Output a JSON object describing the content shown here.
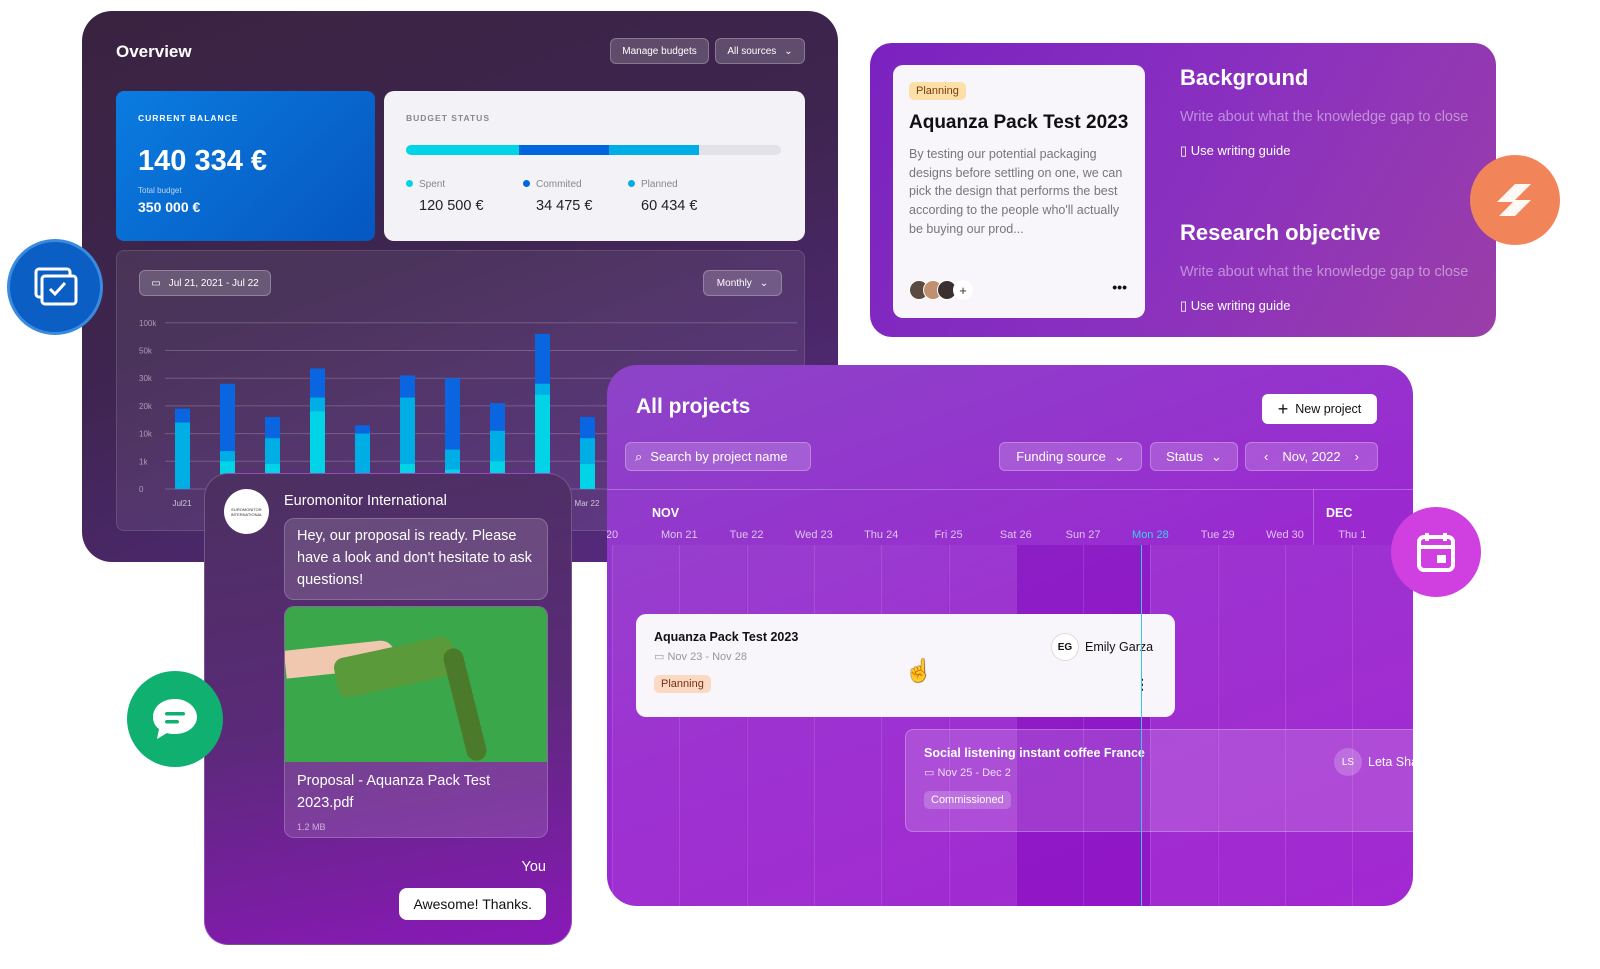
{
  "overview": {
    "title": "Overview",
    "manage_budgets": "Manage budgets",
    "all_sources": "All sources",
    "balance": {
      "label": "CURRENT BALANCE",
      "value": "140 334 €",
      "total_label": "Total budget",
      "total_value": "350 000 €"
    },
    "budget_status": {
      "label": "BUDGET STATUS",
      "progress": {
        "spent": 0.3,
        "committed": 0.24,
        "planned": 0.24
      },
      "items": [
        {
          "name": "Spent",
          "value": "120 500 €",
          "color": "#00d4e6"
        },
        {
          "name": "Commited",
          "value": "34 475 €",
          "color": "#0066e0"
        },
        {
          "name": "Planned",
          "value": "60 434 €",
          "color": "#00aee6"
        }
      ]
    },
    "date_range": "Jul 21, 2021 - Jul 22",
    "period": "Monthly"
  },
  "chart_data": {
    "type": "bar",
    "stacked": true,
    "y_scale": "categorical-nonlinear",
    "y_ticks": [
      "0",
      "1k",
      "10k",
      "20k",
      "30k",
      "50k",
      "100k"
    ],
    "grid": true,
    "x_labels": [
      "Jul21",
      "",
      "",
      "",
      "",
      "",
      "",
      "",
      "",
      "Mar 22"
    ],
    "series": [
      {
        "color": "#00d4e6",
        "values": [
          0,
          1000,
          900,
          18000,
          0,
          900,
          700,
          1000,
          24000,
          900
        ]
      },
      {
        "color": "#00aee6",
        "values": [
          14000,
          4300,
          8500,
          23000,
          10000,
          23000,
          4800,
          11000,
          28000,
          8500
        ]
      },
      {
        "color": "#0a66e0",
        "values": [
          19000,
          28000,
          16000,
          37000,
          13000,
          32000,
          30000,
          21000,
          80000,
          16000
        ]
      }
    ],
    "note_values": "cumulative stack tops"
  },
  "research": {
    "tag": "Planning",
    "title": "Aquanza Pack Test 2023",
    "description": "By testing our potential packaging designs before settling on one, we can pick the design that performs the best according to the people who'll actually be buying our prod...",
    "sections": [
      {
        "title": "Background",
        "placeholder": "Write about what the knowledge gap to close",
        "guide": "Use writing guide"
      },
      {
        "title": "Research objective",
        "placeholder": "Write about what the knowledge gap to close",
        "guide": "Use writing guide"
      }
    ]
  },
  "projects": {
    "title": "All projects",
    "new_project": "New project",
    "search_placeholder": "Search by project name",
    "funding_source": "Funding source",
    "status": "Status",
    "month": "Nov, 2022",
    "months": [
      "NOV",
      "DEC"
    ],
    "days": [
      "20",
      "Mon 21",
      "Tue 22",
      "Wed 23",
      "Thu 24",
      "Fri 25",
      "Sat 26",
      "Sun 27",
      "Mon 28",
      "Tue 29",
      "Wed 30",
      "Thu 1"
    ],
    "today": "Mon 28",
    "items": [
      {
        "name": "Aquanza Pack Test 2023",
        "dates": "Nov 23 - Nov 28",
        "tag": "Planning",
        "initials": "EG",
        "owner": "Emily Garza"
      },
      {
        "name": "Social listening instant coffee France",
        "dates": "Nov 25 - Dec 2",
        "tag": "Commissioned",
        "initials": "LS",
        "owner": "Leta Shaw"
      }
    ]
  },
  "chat": {
    "sender": "Euromonitor International",
    "logo_text": "EUROMONITOR INTERNATIONAL",
    "message": "Hey, our proposal is ready. Please have a look and don't hesitate to ask questions!",
    "file_name": "Proposal - Aquanza Pack Test 2023.pdf",
    "file_size": "1.2 MB",
    "you_label": "You",
    "reply": "Awesome! Thanks."
  },
  "colors": {
    "accent_purple": "#9a2ad0",
    "blue": "#0a66e0",
    "cyan": "#00d4e6",
    "green": "#10b070",
    "orange": "#f2845a",
    "pink": "#d040e0"
  }
}
